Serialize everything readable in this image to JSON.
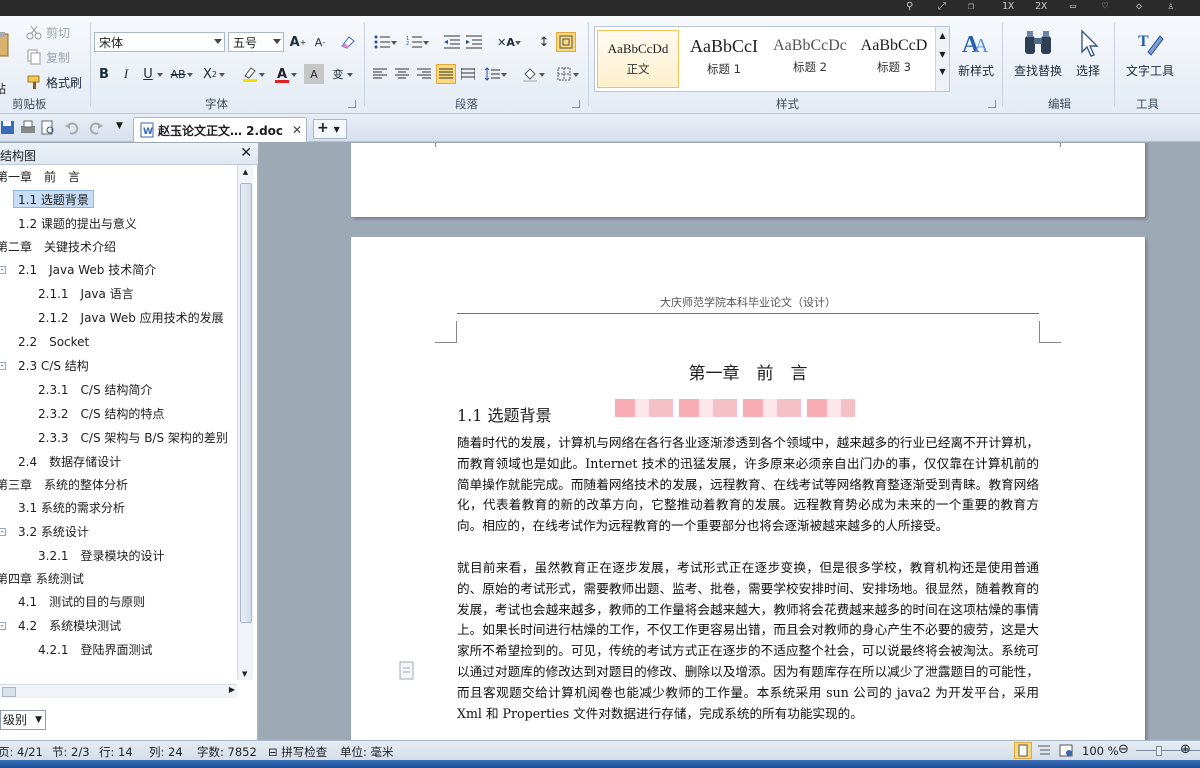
{
  "topbar": {
    "right_items": [
      "1X",
      "2X"
    ]
  },
  "ribbon": {
    "clipboard": {
      "paste_label": "贴",
      "cut": "剪切",
      "copy": "复制",
      "format_painter": "格式刷",
      "group": "剪贴板"
    },
    "font": {
      "name": "宋体",
      "size": "五号",
      "group": "字体"
    },
    "paragraph": {
      "group": "段落"
    },
    "styles": {
      "group": "样式",
      "items": [
        {
          "preview": "AaBbCcDd",
          "name": "正文"
        },
        {
          "preview": "AaBbCcI",
          "name": "标题 1"
        },
        {
          "preview": "AaBbCcDc",
          "name": "标题 2"
        },
        {
          "preview": "AaBbCcD",
          "name": "标题 3"
        }
      ]
    },
    "new_style": "新样式",
    "find_replace": "查找替换",
    "select": "选择",
    "text_tools": "文字工具",
    "edit_group": "编辑",
    "tools_group": "工具"
  },
  "tabbar": {
    "doc_title": "赵玉论文正文… 2.doc"
  },
  "nav": {
    "title": "结构图",
    "items": [
      {
        "label": "第一章　前　言"
      },
      {
        "label": "1.1  选题背景"
      },
      {
        "label": "1.2  课题的提出与意义"
      },
      {
        "label": "第二章　关键技术介绍"
      },
      {
        "label": "2.1　Java Web 技术简介"
      },
      {
        "label": "2.1.1　Java 语言"
      },
      {
        "label": "2.1.2　Java Web 应用技术的发展"
      },
      {
        "label": "2.2　Socket"
      },
      {
        "label": "2.3 C/S 结构"
      },
      {
        "label": "2.3.1　C/S 结构简介"
      },
      {
        "label": "2.3.2　C/S 结构的特点"
      },
      {
        "label": "2.3.3　C/S 架构与 B/S 架构的差别"
      },
      {
        "label": "2.4　数据存储设计"
      },
      {
        "label": "第三章　系统的整体分析"
      },
      {
        "label": "3.1  系统的需求分析"
      },
      {
        "label": "3.2  系统设计"
      },
      {
        "label": "3.2.1　登录模块的设计"
      },
      {
        "label": "第四章  系统测试"
      },
      {
        "label": "4.1　测试的目的与原则"
      },
      {
        "label": "4.2　系统模块测试"
      },
      {
        "label": "4.2.1　登陆界面测试"
      }
    ],
    "level_select": "级别"
  },
  "document": {
    "header": "大庆师范学院本科毕业论文（设计）",
    "chapter_title": "第一章　前　言",
    "section_title": "1.1  选题背景",
    "paragraphs": [
      "随着时代的发展，计算机与网络在各行各业逐渐渗透到各个领域中，越来越多的行业已经离不开计算机，而教育领域也是如此。Internet 技术的迅猛发展，许多原来必须亲自出门办的事，仅仅靠在计算机前的简单操作就能完成。而随着网络技术的发展，远程教育、在线考试等网络教育整逐渐受到青睐。教育网络化，代表着教育的新的改革方向，它整推动着教育的发展。远程教育势必成为未来的一个重要的教育方向。相应的，在线考试作为远程教育的一个重要部分也将会逐渐被越来越多的人所接受。",
      "就目前来看，虽然教育正在逐步发展，考试形式正在逐步变换，但是很多学校，教育机构还是使用普通的、原始的考试形式，需要教师出题、监考、批卷，需要学校安排时间、安排场地。很显然，随着教育的发展，考试也会越来越多，教师的工作量将会越来越大，教师将会花费越来越多的时间在这项枯燥的事情上。如果长时间进行枯燥的工作，不仅工作更容易出错，而且会对教师的身心产生不必要的疲劳，这是大家所不希望捡到的。可见，传统的考试方式正在逐步的不适应整个社会，可以说最终将会被淘汰。系统可以通过对题库的修改达到对题目的修改、删除以及增添。因为有题库存在所以减少了泄露题目的可能性，而且客观题交给计算机阅卷也能减少教师的工作量。本系统采用 sun 公司的 java2 为开发平台，采用 Xml 和 Properties 文件对数据进行存储，完成系统的所有功能实现的。"
    ]
  },
  "status": {
    "page": "页: 4/21",
    "section": "节: 2/3",
    "row": "行: 14",
    "col": "列: 24",
    "words": "字数: 7852",
    "spell": "拼写检查",
    "unit": "单位: 毫米",
    "zoom": "100 %"
  }
}
